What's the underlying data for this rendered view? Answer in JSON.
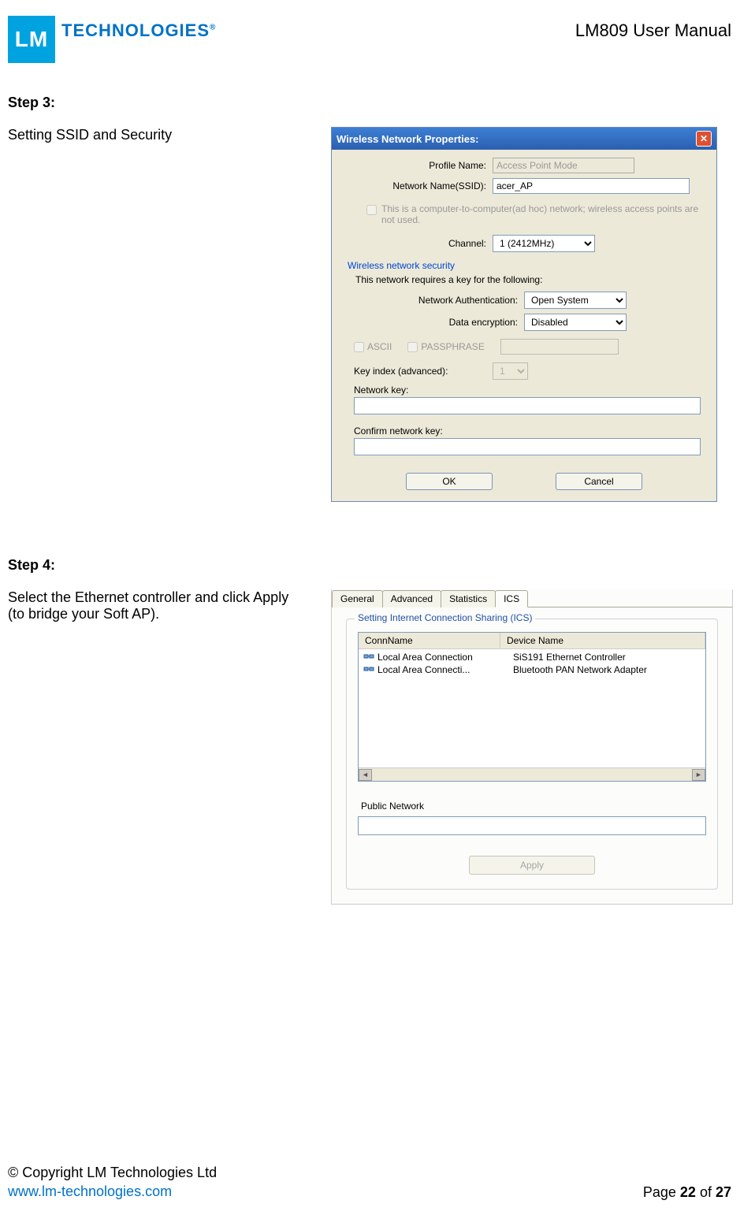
{
  "header": {
    "logo_initials": "LM",
    "logo_brand": "TECHNOLOGIES",
    "doc_title": "LM809 User Manual"
  },
  "step3": {
    "heading": "Step 3:",
    "text": "Setting SSID and Security"
  },
  "dialog1": {
    "title": "Wireless Network Properties:",
    "profile_label": "Profile Name:",
    "profile_value": "Access Point Mode",
    "ssid_label": "Network Name(SSID):",
    "ssid_value": "acer_AP",
    "adhoc_text": "This is a computer-to-computer(ad hoc) network; wireless access points are not used.",
    "channel_label": "Channel:",
    "channel_value": "1  (2412MHz)",
    "security_heading": "Wireless network security",
    "security_text": "This network requires a key for the following:",
    "auth_label": "Network Authentication:",
    "auth_value": "Open System",
    "enc_label": "Data encryption:",
    "enc_value": "Disabled",
    "ascii": "ASCII",
    "passphrase": "PASSPHRASE",
    "key_index_label": "Key index (advanced):",
    "key_index_value": "1",
    "net_key_label": "Network key:",
    "confirm_key_label": "Confirm network key:",
    "ok": "OK",
    "cancel": "Cancel"
  },
  "step4": {
    "heading": "Step 4:",
    "text": "Select the Ethernet controller and click Apply (to bridge your Soft AP)."
  },
  "dialog2": {
    "tabs": [
      "General",
      "Advanced",
      "Statistics",
      "ICS"
    ],
    "legend": "Setting Internet Connection Sharing (ICS)",
    "col_conn": "ConnName",
    "col_device": "Device Name",
    "rows": [
      {
        "conn": "Local Area Connection",
        "device": "SiS191 Ethernet Controller"
      },
      {
        "conn": "Local Area Connecti...",
        "device": "Bluetooth PAN Network Adapter"
      }
    ],
    "public_label": "Public Network",
    "apply": "Apply"
  },
  "footer": {
    "copyright": "© Copyright LM Technologies Ltd",
    "link": "www.lm-technologies.com",
    "page_prefix": "Page ",
    "page_current": "22",
    "page_of": " of ",
    "page_total": "27"
  }
}
